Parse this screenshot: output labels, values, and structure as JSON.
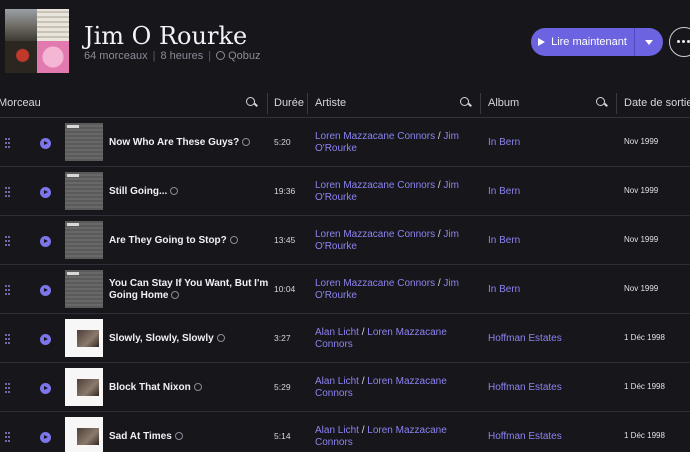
{
  "header": {
    "title": "Jim O Rourke",
    "tracks_count": "64 morceaux",
    "duration": "8 heures",
    "source": "Qobuz",
    "play_label": "Lire maintenant"
  },
  "columns": {
    "track": "Morceau",
    "duration": "Durée",
    "artist": "Artiste",
    "album": "Album",
    "release": "Date de sortie"
  },
  "rows": [
    {
      "title": "Now Who Are These Guys?",
      "duration": "5:20",
      "artists": [
        "Loren Mazzacane Connors",
        "Jim O'Rourke"
      ],
      "album": "In Bern",
      "date": "Nov 1999",
      "cover": "grey"
    },
    {
      "title": "Still Going...",
      "duration": "19:36",
      "artists": [
        "Loren Mazzacane Connors",
        "Jim O'Rourke"
      ],
      "album": "In Bern",
      "date": "Nov 1999",
      "cover": "grey"
    },
    {
      "title": "Are They Going to Stop?",
      "duration": "13:45",
      "artists": [
        "Loren Mazzacane Connors",
        "Jim O'Rourke"
      ],
      "album": "In Bern",
      "date": "Nov 1999",
      "cover": "grey"
    },
    {
      "title": "You Can Stay If You Want, But I'm Going Home",
      "duration": "10:04",
      "artists": [
        "Loren Mazzacane Connors",
        "Jim O'Rourke"
      ],
      "album": "In Bern",
      "date": "Nov 1999",
      "cover": "grey"
    },
    {
      "title": "Slowly, Slowly, Slowly",
      "duration": "3:27",
      "artists": [
        "Alan Licht",
        "Loren Mazzacane Connors"
      ],
      "album": "Hoffman Estates",
      "date": "1 Déc 1998",
      "cover": "white"
    },
    {
      "title": "Block That Nixon",
      "duration": "5:29",
      "artists": [
        "Alan Licht",
        "Loren Mazzacane Connors"
      ],
      "album": "Hoffman Estates",
      "date": "1 Déc 1998",
      "cover": "white"
    },
    {
      "title": "Sad At Times",
      "duration": "5:14",
      "artists": [
        "Alan Licht",
        "Loren Mazzacane Connors"
      ],
      "album": "Hoffman Estates",
      "date": "1 Déc 1998",
      "cover": "white"
    }
  ],
  "icons": {
    "play": "play-icon",
    "search": "search-icon",
    "qobuz": "qobuz-icon",
    "more": "more-icon",
    "drag": "drag-handle-icon"
  },
  "colors": {
    "accent": "#6c63e0",
    "link": "#8b84f0",
    "background": "#17161b"
  }
}
